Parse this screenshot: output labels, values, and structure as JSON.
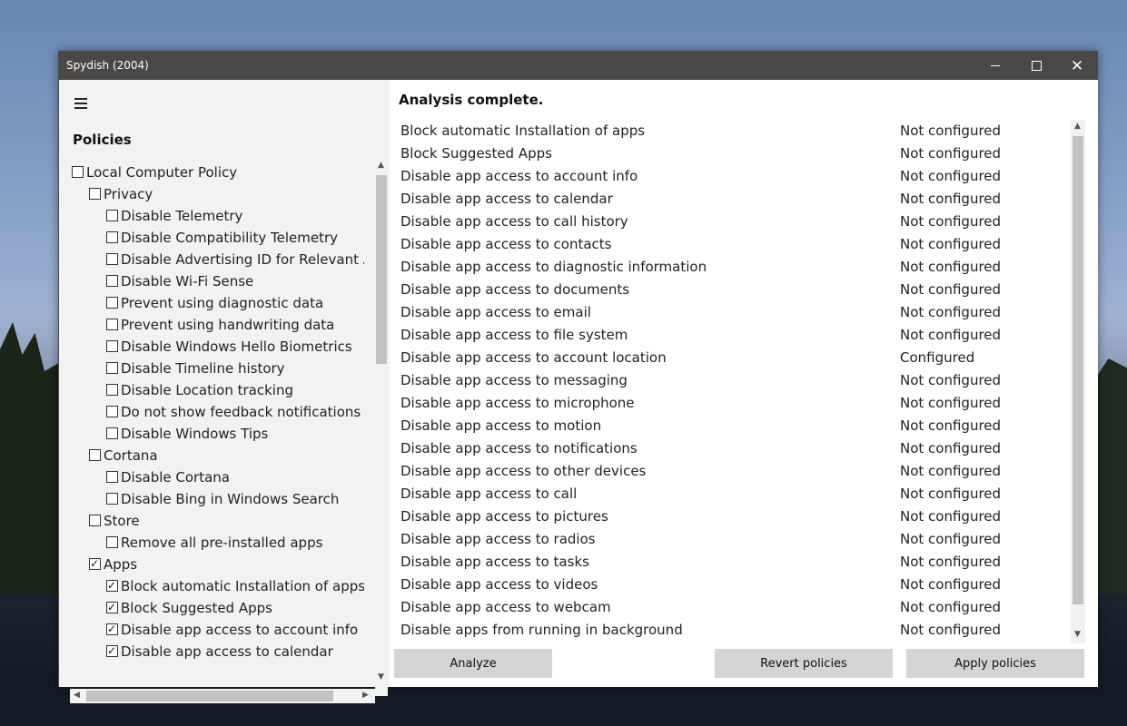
{
  "window": {
    "title": "Spydish (2004)"
  },
  "left": {
    "heading": "Policies",
    "tree": [
      {
        "label": "Local Computer Policy",
        "level": 0,
        "checked": false
      },
      {
        "label": "Privacy",
        "level": 1,
        "checked": false
      },
      {
        "label": "Disable Telemetry",
        "level": 2,
        "checked": false
      },
      {
        "label": "Disable Compatibility Telemetry",
        "level": 2,
        "checked": false
      },
      {
        "label": "Disable Advertising ID for Relevant Ads",
        "level": 2,
        "checked": false
      },
      {
        "label": "Disable Wi-Fi Sense",
        "level": 2,
        "checked": false
      },
      {
        "label": "Prevent using diagnostic data",
        "level": 2,
        "checked": false
      },
      {
        "label": "Prevent using handwriting data",
        "level": 2,
        "checked": false
      },
      {
        "label": "Disable Windows Hello Biometrics",
        "level": 2,
        "checked": false
      },
      {
        "label": "Disable Timeline history",
        "level": 2,
        "checked": false
      },
      {
        "label": "Disable Location tracking",
        "level": 2,
        "checked": false
      },
      {
        "label": "Do not show feedback notifications",
        "level": 2,
        "checked": false
      },
      {
        "label": "Disable Windows Tips",
        "level": 2,
        "checked": false
      },
      {
        "label": "Cortana",
        "level": 1,
        "checked": false
      },
      {
        "label": "Disable Cortana",
        "level": 2,
        "checked": false
      },
      {
        "label": "Disable Bing in Windows Search",
        "level": 2,
        "checked": false
      },
      {
        "label": "Store",
        "level": 1,
        "checked": false
      },
      {
        "label": "Remove all pre-installed apps",
        "level": 2,
        "checked": false
      },
      {
        "label": "Apps",
        "level": 1,
        "checked": true
      },
      {
        "label": "Block automatic Installation of apps",
        "level": 2,
        "checked": true
      },
      {
        "label": "Block Suggested Apps",
        "level": 2,
        "checked": true
      },
      {
        "label": "Disable app access to account info",
        "level": 2,
        "checked": true
      },
      {
        "label": "Disable app access to calendar",
        "level": 2,
        "checked": true
      }
    ]
  },
  "right": {
    "status": "Analysis complete.",
    "rows": [
      {
        "name": "Block automatic Installation of apps",
        "state": "Not configured"
      },
      {
        "name": "Block Suggested Apps",
        "state": "Not configured"
      },
      {
        "name": "Disable app access to account info",
        "state": "Not configured"
      },
      {
        "name": "Disable app access to calendar",
        "state": "Not configured"
      },
      {
        "name": "Disable app access to call history",
        "state": "Not configured"
      },
      {
        "name": "Disable app access to contacts",
        "state": "Not configured"
      },
      {
        "name": "Disable app access to diagnostic information",
        "state": "Not configured"
      },
      {
        "name": "Disable app access to documents",
        "state": "Not configured"
      },
      {
        "name": "Disable app access to email",
        "state": "Not configured"
      },
      {
        "name": "Disable app access to file system",
        "state": "Not configured"
      },
      {
        "name": "Disable app access to account location",
        "state": "Configured"
      },
      {
        "name": "Disable app access to messaging",
        "state": "Not configured"
      },
      {
        "name": "Disable app access to microphone",
        "state": "Not configured"
      },
      {
        "name": "Disable app access to motion",
        "state": "Not configured"
      },
      {
        "name": "Disable app access to notifications",
        "state": "Not configured"
      },
      {
        "name": "Disable app access to other devices",
        "state": "Not configured"
      },
      {
        "name": "Disable app access to call",
        "state": "Not configured"
      },
      {
        "name": "Disable app access to pictures",
        "state": "Not configured"
      },
      {
        "name": "Disable app access to radios",
        "state": "Not configured"
      },
      {
        "name": "Disable app access to tasks",
        "state": "Not configured"
      },
      {
        "name": "Disable app access to videos",
        "state": "Not configured"
      },
      {
        "name": "Disable app access to webcam",
        "state": "Not configured"
      },
      {
        "name": "Disable apps from running in background",
        "state": "Not configured"
      }
    ],
    "buttons": {
      "analyze": "Analyze",
      "revert": "Revert policies",
      "apply": "Apply policies"
    }
  },
  "icons": {
    "minimize": "minimize-icon",
    "maximize": "maximize-icon",
    "close": "close-icon",
    "menu": "hamburger-menu-icon"
  }
}
